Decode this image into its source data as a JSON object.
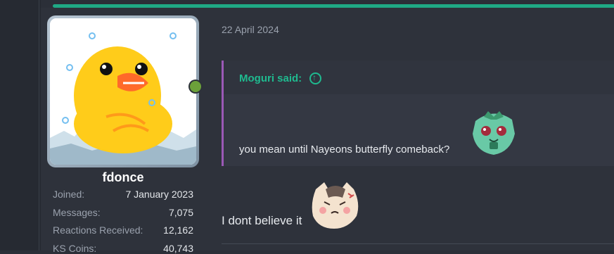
{
  "post": {
    "date": "22 April 2024"
  },
  "user": {
    "name": "fdonce",
    "stats": [
      {
        "label": "Joined:",
        "value": "7 January 2023"
      },
      {
        "label": "Messages:",
        "value": "7,075"
      },
      {
        "label": "Reactions Received:",
        "value": "12,162"
      },
      {
        "label": "KS Coins:",
        "value": "40,743"
      }
    ]
  },
  "quote": {
    "author": "Moguri said:",
    "text": "you mean until Nayeons butterfly comeback?"
  },
  "reply": {
    "text": "I dont believe it"
  },
  "colors": {
    "accent": "#1fa985",
    "quote_border": "#9b59b6",
    "online": "#6ca13a"
  },
  "icons": {
    "quote_jump": "arrow-up-circle-icon",
    "online": "online-status-icon"
  }
}
